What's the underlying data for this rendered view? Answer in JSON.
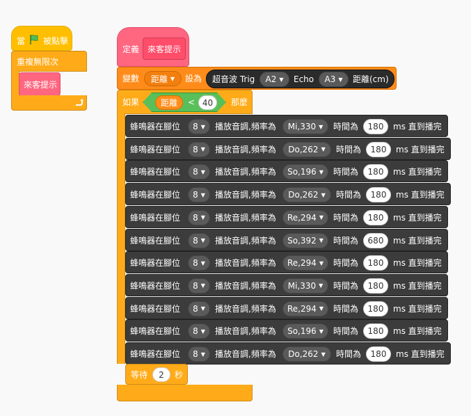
{
  "script1": {
    "when_label": "當",
    "flag_icon": "green-flag-icon",
    "clicked_label": "被點擊",
    "forever_label": "重複無限次",
    "call_label": "來客提示",
    "loop_icon": "loop-arrow-icon"
  },
  "script2": {
    "define_label": "定義",
    "define_name": "來客提示",
    "set_label": "變數",
    "set_var": "距離",
    "set_to": "設為",
    "ultra_label": "超音波 Trig",
    "trig_pin": "A2",
    "echo_label": "Echo",
    "echo_pin": "A3",
    "dist_label": "距離(cm)",
    "if_label": "如果",
    "cond_var": "距離",
    "cond_op": "<",
    "cond_value": "40",
    "then_label": "那麼",
    "buzzer": {
      "prefix": "蜂鳴器在腳位",
      "pin_label": "播放音調,頻率為",
      "time_label": "時間為",
      "suffix": "ms 直到播完"
    },
    "notes": [
      {
        "pin": "8",
        "tone": "Mi,330",
        "ms": "180"
      },
      {
        "pin": "8",
        "tone": "Do,262",
        "ms": "180"
      },
      {
        "pin": "8",
        "tone": "So,196",
        "ms": "180"
      },
      {
        "pin": "8",
        "tone": "Do,262",
        "ms": "180"
      },
      {
        "pin": "8",
        "tone": "Re,294",
        "ms": "180"
      },
      {
        "pin": "8",
        "tone": "So,392",
        "ms": "680"
      },
      {
        "pin": "8",
        "tone": "Re,294",
        "ms": "180"
      },
      {
        "pin": "8",
        "tone": "Mi,330",
        "ms": "180"
      },
      {
        "pin": "8",
        "tone": "Re,294",
        "ms": "180"
      },
      {
        "pin": "8",
        "tone": "So,196",
        "ms": "180"
      },
      {
        "pin": "8",
        "tone": "Do,262",
        "ms": "180"
      }
    ],
    "wait_label": "等待",
    "wait_value": "2",
    "wait_unit": "秒"
  },
  "colors": {
    "event": "#ffbf00",
    "control": "#ffab19",
    "custom": "#ff6680",
    "variable": "#ff8c1a",
    "operator": "#59c059",
    "extension": "#3c3c3c"
  }
}
